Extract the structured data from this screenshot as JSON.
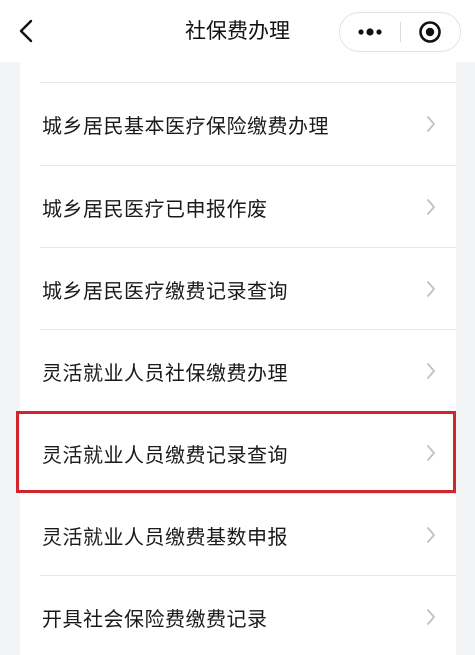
{
  "header": {
    "title": "社保费办理",
    "back_icon": "chevron-left-icon",
    "more_icon": "more-dots-icon",
    "close_icon": "target-circle-icon"
  },
  "list": {
    "items": [
      {
        "label": "城乡居民基本医疗保险缴费办理"
      },
      {
        "label": "城乡居民医疗已申报作废"
      },
      {
        "label": "城乡居民医疗缴费记录查询"
      },
      {
        "label": "灵活就业人员社保缴费办理"
      },
      {
        "label": "灵活就业人员缴费记录查询",
        "highlighted": true
      },
      {
        "label": "灵活就业人员缴费基数申报"
      },
      {
        "label": "开具社会保险费缴费记录"
      }
    ]
  },
  "colors": {
    "highlight": "#d2262c",
    "background": "#f3f4f6",
    "text": "#1a1a1a",
    "arrow": "#c2c2c2"
  }
}
